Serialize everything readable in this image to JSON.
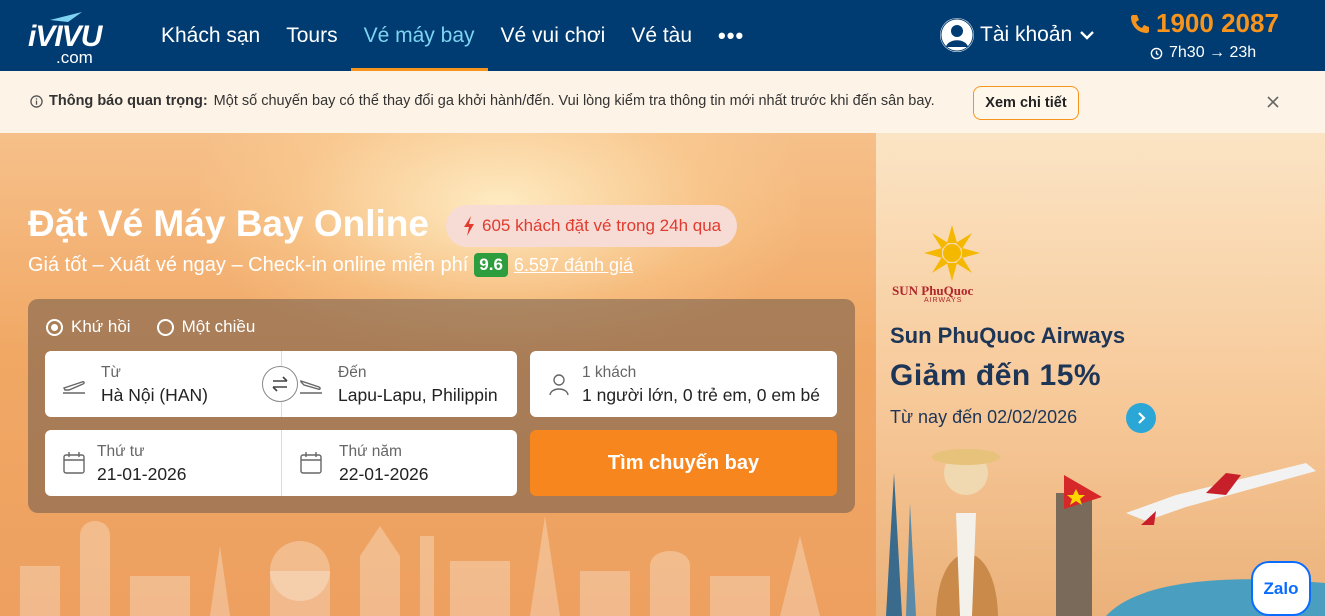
{
  "nav": {
    "logo_main": "iVIVU",
    "logo_sub": ".com",
    "menu": [
      {
        "label": "Khách sạn"
      },
      {
        "label": "Tours"
      },
      {
        "label": "Vé máy bay"
      },
      {
        "label": "Vé vui chơi"
      },
      {
        "label": "Vé tàu"
      }
    ],
    "more": "•••",
    "account_label": "Tài khoản",
    "hotline": "1900 2087",
    "hours": "7h30 → 23h"
  },
  "notice": {
    "title": "Thông báo quan trọng:",
    "text": "Một số chuyến bay có thể thay đổi ga khởi hành/đến. Vui lòng kiểm tra thông tin mới nhất trước khi đến sân bay.",
    "button": "Xem chi tiết"
  },
  "hero": {
    "title": "Đặt Vé Máy Bay Online",
    "badge": "605 khách đặt vé trong 24h qua",
    "subtitle": "Giá tốt – Xuất vé ngay – Check-in online miễn phí",
    "score": "9.6",
    "reviews": "6.597 đánh giá"
  },
  "search": {
    "trip_types": [
      {
        "label": "Khứ hồi",
        "selected": true
      },
      {
        "label": "Một chiều",
        "selected": false
      }
    ],
    "from": {
      "label": "Từ",
      "value": "Hà Nội (HAN)"
    },
    "to": {
      "label": "Đến",
      "value": "Lapu-Lapu, Philippin"
    },
    "passengers": {
      "label": "1 khách",
      "value": "1 người lớn, 0 trẻ em, 0 em bé"
    },
    "depart": {
      "label": "Thứ tư",
      "value": "21-01-2026"
    },
    "return": {
      "label": "Thứ năm",
      "value": "22-01-2026"
    },
    "button": "Tìm chuyến bay"
  },
  "promo": {
    "logo_text": "SUN PhuQuoc",
    "logo_sub": "AIRWAYS",
    "name": "Sun PhuQuoc Airways",
    "deal": "Giảm đến 15%",
    "date": "Từ nay đến 02/02/2026"
  },
  "zalo": "Zalo",
  "colors": {
    "nav_bg": "#003c71",
    "accent_orange": "#f7861e",
    "active_blue": "#7fd3f2",
    "score_green": "#2e9d3e",
    "badge_red": "#e13b2f"
  }
}
